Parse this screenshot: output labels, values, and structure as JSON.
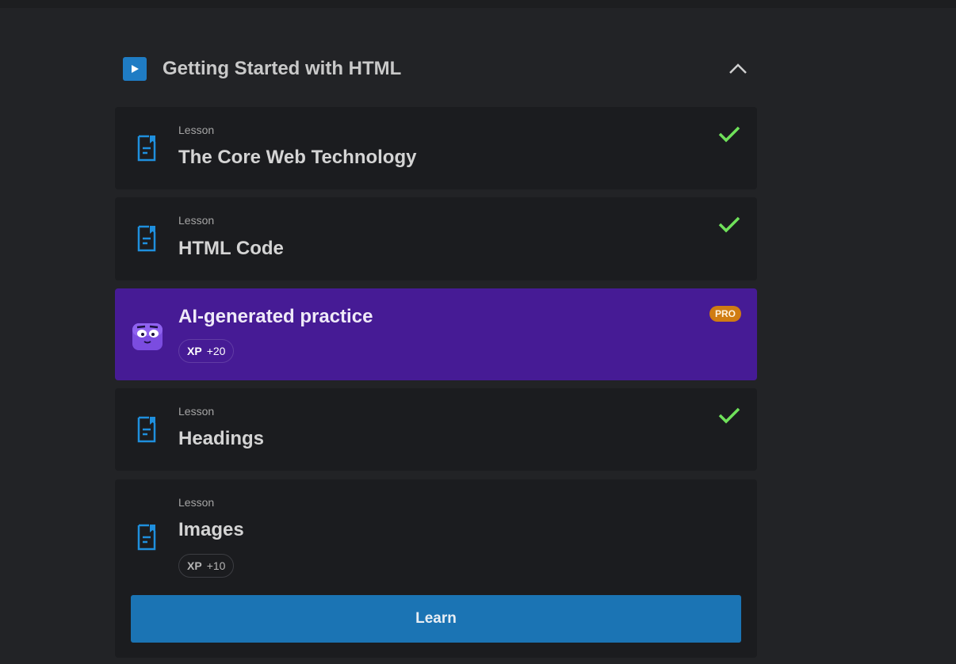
{
  "module": {
    "title": "Getting Started with HTML"
  },
  "lessons": [
    {
      "kind": "Lesson",
      "title": "The Core Web Technology",
      "completed": true
    },
    {
      "kind": "Lesson",
      "title": "HTML Code",
      "completed": true
    },
    {
      "kind": "Lesson",
      "title": "Headings",
      "completed": true
    },
    {
      "kind": "Lesson",
      "title": "Images",
      "completed": false,
      "xp_label": "XP",
      "xp_value": "+10"
    }
  ],
  "ai_practice": {
    "title": "AI-generated practice",
    "badge": "PRO",
    "xp_label": "XP",
    "xp_value": "+20"
  },
  "learn_button": {
    "label": "Learn"
  },
  "colors": {
    "accent_blue": "#1f7cc4",
    "check_green": "#6fe15a",
    "ai_purple": "#461b95",
    "pro_orange": "#d07c12"
  },
  "icons": {
    "module_play": "play-icon",
    "collapse": "chevron-up-icon",
    "lesson": "document-icon",
    "completed": "check-icon",
    "ai_mascot": "mascot-icon"
  }
}
